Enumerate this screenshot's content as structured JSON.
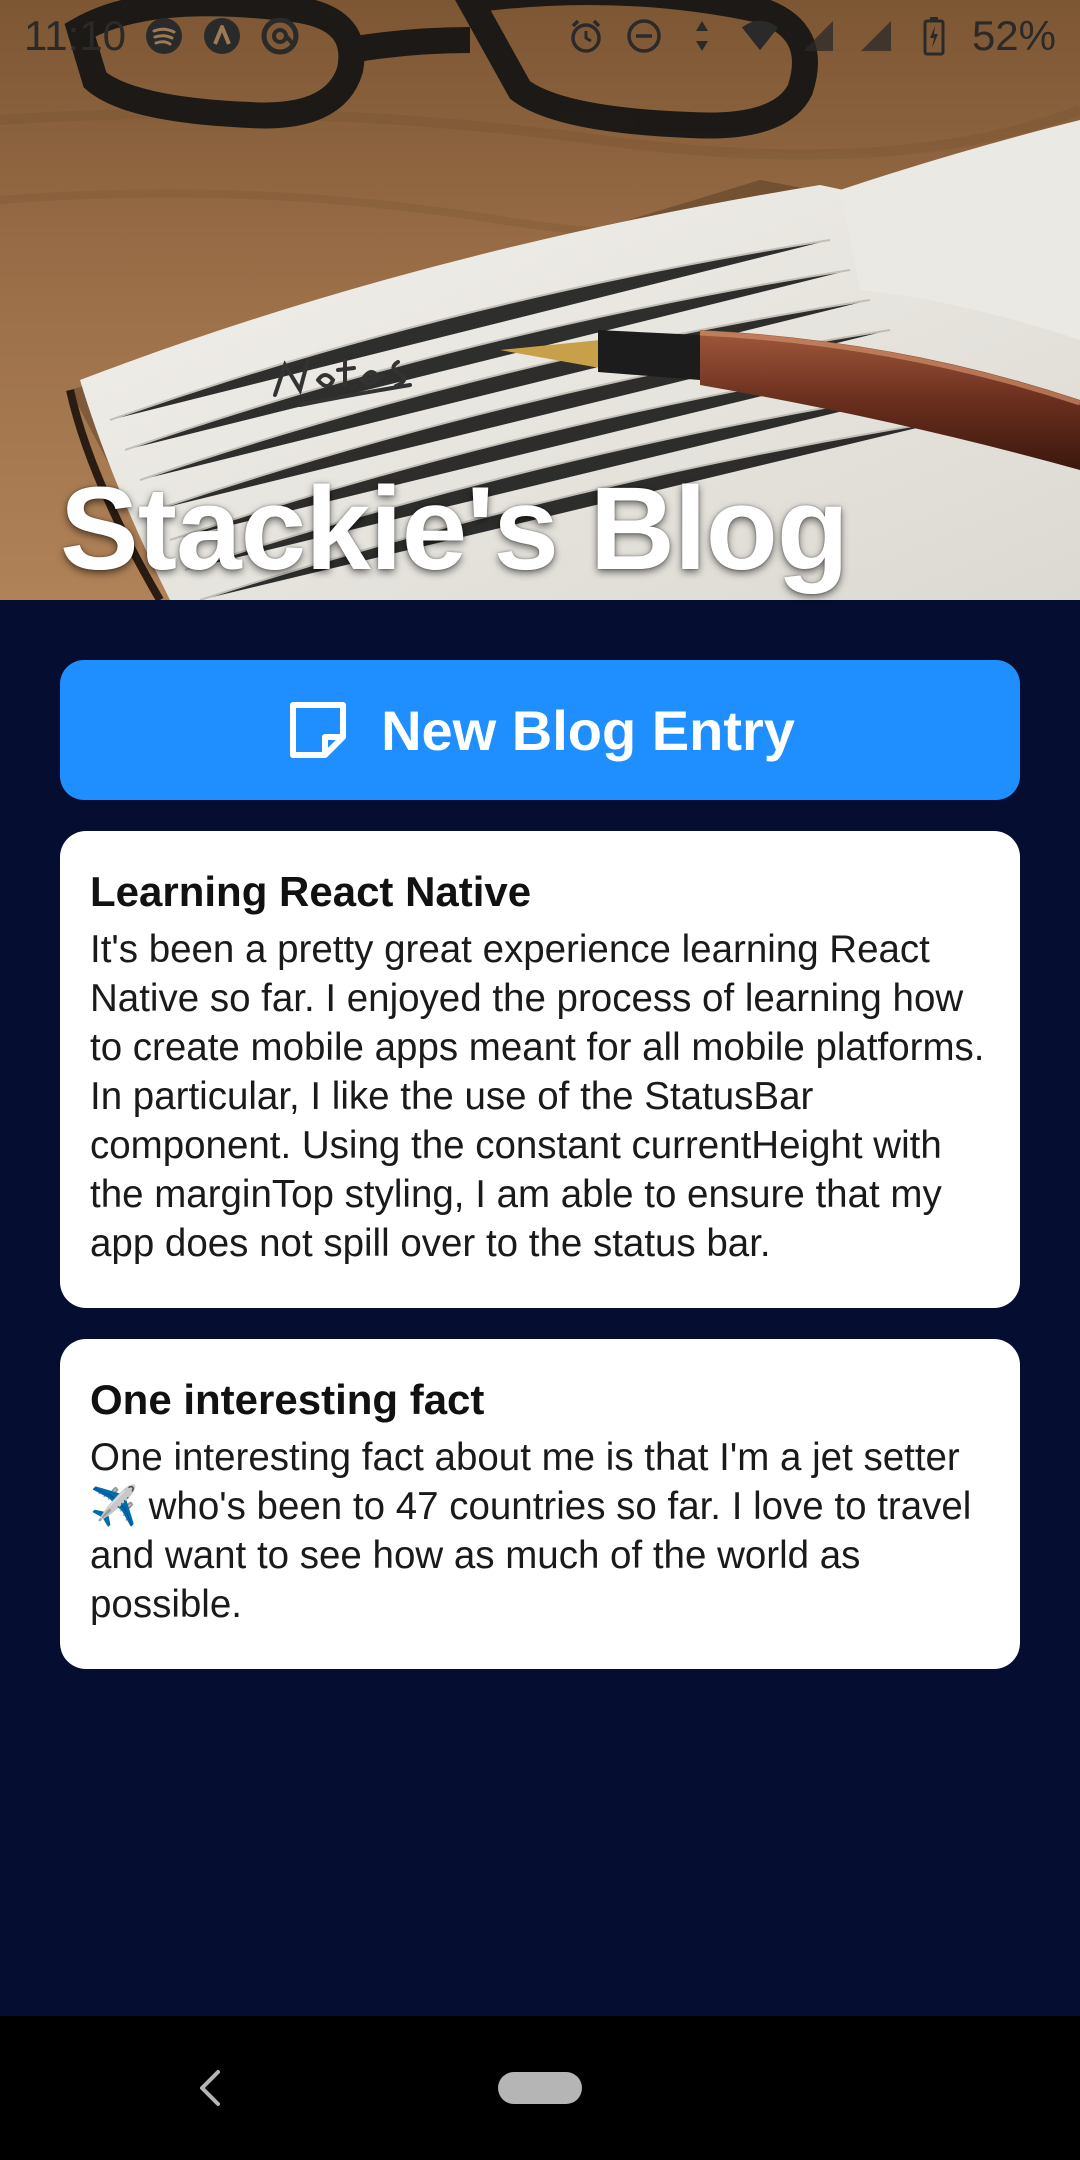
{
  "status_bar": {
    "time": "11:10",
    "battery_percent": "52%",
    "left_icons": [
      "spotify-icon",
      "a-icon",
      "at-icon"
    ],
    "right_icons": [
      "alarm-icon",
      "dnd-icon",
      "data-arrows-icon",
      "wifi-icon",
      "signal-icon",
      "signal-icon",
      "battery-charging-icon"
    ]
  },
  "header": {
    "title": "Stackie's Blog",
    "background_image": "notebook-with-pen-photo"
  },
  "new_entry_button": {
    "label": "New Blog Entry",
    "icon": "sticky-note-icon",
    "color": "#1f8fff"
  },
  "posts": [
    {
      "title": "Learning React Native",
      "body": "It's been a pretty great experience learning React Native so far. I enjoyed the process of learning how to create mobile apps meant for all mobile platforms. In particular, I like the use of the StatusBar component. Using the constant currentHeight with the marginTop styling, I am able to ensure that my app does not spill over to the status bar."
    },
    {
      "title": "One interesting fact",
      "body": "One interesting fact about me is that I'm a jet setter ✈️ who's been to 47 countries so far. I love to travel and want to see how as much of the world as possible."
    }
  ],
  "colors": {
    "background": "#050e30",
    "accent": "#1f8fff",
    "card": "#ffffff",
    "nav_bar": "#000000"
  },
  "nav_bar": {
    "icons": [
      "back-icon",
      "home-pill-icon"
    ]
  }
}
